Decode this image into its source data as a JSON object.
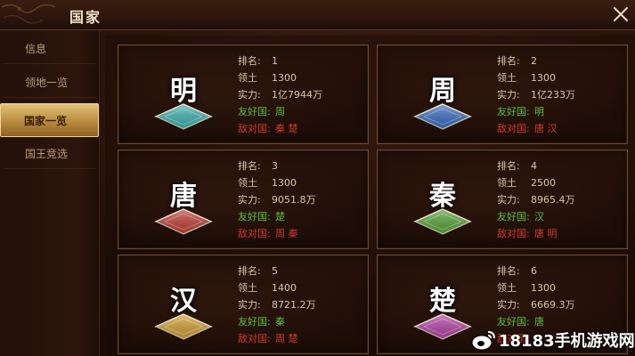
{
  "window": {
    "title": "国家"
  },
  "sidebar": {
    "items": [
      {
        "label": "信息",
        "active": false
      },
      {
        "label": "领地一览",
        "active": false
      },
      {
        "label": "国家一览",
        "active": true
      },
      {
        "label": "国王竞选",
        "active": false
      }
    ]
  },
  "labels": {
    "rank": "排名:",
    "territory": "领土",
    "power": "实力:",
    "friendly": "友好国:",
    "hostile": "敌对国:"
  },
  "countries": [
    {
      "glyph": "明",
      "rank": "1",
      "territory": "1300",
      "power": "1亿7944万",
      "friendly": "周",
      "hostile": "秦 楚",
      "color": "#3fb3b0"
    },
    {
      "glyph": "周",
      "rank": "2",
      "territory": "1300",
      "power": "1亿233万",
      "friendly": "明",
      "hostile": "唐 汉",
      "color": "#3a6fc2"
    },
    {
      "glyph": "唐",
      "rank": "3",
      "territory": "1300",
      "power": "9051.8万",
      "friendly": "楚",
      "hostile": "周 秦",
      "color": "#c2403a"
    },
    {
      "glyph": "秦",
      "rank": "4",
      "territory": "2500",
      "power": "8965.4万",
      "friendly": "汉",
      "hostile": "唐 明",
      "color": "#5aa43a"
    },
    {
      "glyph": "汉",
      "rank": "5",
      "territory": "1400",
      "power": "8721.2万",
      "friendly": "秦",
      "hostile": "周 楚",
      "color": "#d2a032"
    },
    {
      "glyph": "楚",
      "rank": "6",
      "territory": "1300",
      "power": "6669.3万",
      "friendly": "唐",
      "hostile": "",
      "color": "#b544a8"
    }
  ],
  "watermark": {
    "text": "18183手机游戏网"
  },
  "icons": {
    "close": "close-icon",
    "watermark": "weibo-icon"
  }
}
